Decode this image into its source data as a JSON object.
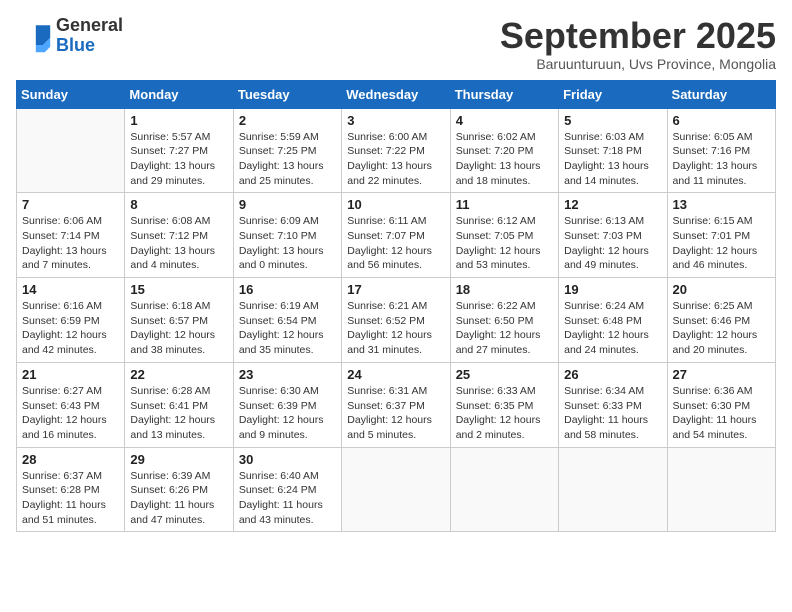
{
  "logo": {
    "general": "General",
    "blue": "Blue"
  },
  "title": "September 2025",
  "location": "Baruunturuun, Uvs Province, Mongolia",
  "days_of_week": [
    "Sunday",
    "Monday",
    "Tuesday",
    "Wednesday",
    "Thursday",
    "Friday",
    "Saturday"
  ],
  "weeks": [
    [
      {
        "day": "",
        "info": ""
      },
      {
        "day": "1",
        "info": "Sunrise: 5:57 AM\nSunset: 7:27 PM\nDaylight: 13 hours\nand 29 minutes."
      },
      {
        "day": "2",
        "info": "Sunrise: 5:59 AM\nSunset: 7:25 PM\nDaylight: 13 hours\nand 25 minutes."
      },
      {
        "day": "3",
        "info": "Sunrise: 6:00 AM\nSunset: 7:22 PM\nDaylight: 13 hours\nand 22 minutes."
      },
      {
        "day": "4",
        "info": "Sunrise: 6:02 AM\nSunset: 7:20 PM\nDaylight: 13 hours\nand 18 minutes."
      },
      {
        "day": "5",
        "info": "Sunrise: 6:03 AM\nSunset: 7:18 PM\nDaylight: 13 hours\nand 14 minutes."
      },
      {
        "day": "6",
        "info": "Sunrise: 6:05 AM\nSunset: 7:16 PM\nDaylight: 13 hours\nand 11 minutes."
      }
    ],
    [
      {
        "day": "7",
        "info": "Sunrise: 6:06 AM\nSunset: 7:14 PM\nDaylight: 13 hours\nand 7 minutes."
      },
      {
        "day": "8",
        "info": "Sunrise: 6:08 AM\nSunset: 7:12 PM\nDaylight: 13 hours\nand 4 minutes."
      },
      {
        "day": "9",
        "info": "Sunrise: 6:09 AM\nSunset: 7:10 PM\nDaylight: 13 hours\nand 0 minutes."
      },
      {
        "day": "10",
        "info": "Sunrise: 6:11 AM\nSunset: 7:07 PM\nDaylight: 12 hours\nand 56 minutes."
      },
      {
        "day": "11",
        "info": "Sunrise: 6:12 AM\nSunset: 7:05 PM\nDaylight: 12 hours\nand 53 minutes."
      },
      {
        "day": "12",
        "info": "Sunrise: 6:13 AM\nSunset: 7:03 PM\nDaylight: 12 hours\nand 49 minutes."
      },
      {
        "day": "13",
        "info": "Sunrise: 6:15 AM\nSunset: 7:01 PM\nDaylight: 12 hours\nand 46 minutes."
      }
    ],
    [
      {
        "day": "14",
        "info": "Sunrise: 6:16 AM\nSunset: 6:59 PM\nDaylight: 12 hours\nand 42 minutes."
      },
      {
        "day": "15",
        "info": "Sunrise: 6:18 AM\nSunset: 6:57 PM\nDaylight: 12 hours\nand 38 minutes."
      },
      {
        "day": "16",
        "info": "Sunrise: 6:19 AM\nSunset: 6:54 PM\nDaylight: 12 hours\nand 35 minutes."
      },
      {
        "day": "17",
        "info": "Sunrise: 6:21 AM\nSunset: 6:52 PM\nDaylight: 12 hours\nand 31 minutes."
      },
      {
        "day": "18",
        "info": "Sunrise: 6:22 AM\nSunset: 6:50 PM\nDaylight: 12 hours\nand 27 minutes."
      },
      {
        "day": "19",
        "info": "Sunrise: 6:24 AM\nSunset: 6:48 PM\nDaylight: 12 hours\nand 24 minutes."
      },
      {
        "day": "20",
        "info": "Sunrise: 6:25 AM\nSunset: 6:46 PM\nDaylight: 12 hours\nand 20 minutes."
      }
    ],
    [
      {
        "day": "21",
        "info": "Sunrise: 6:27 AM\nSunset: 6:43 PM\nDaylight: 12 hours\nand 16 minutes."
      },
      {
        "day": "22",
        "info": "Sunrise: 6:28 AM\nSunset: 6:41 PM\nDaylight: 12 hours\nand 13 minutes."
      },
      {
        "day": "23",
        "info": "Sunrise: 6:30 AM\nSunset: 6:39 PM\nDaylight: 12 hours\nand 9 minutes."
      },
      {
        "day": "24",
        "info": "Sunrise: 6:31 AM\nSunset: 6:37 PM\nDaylight: 12 hours\nand 5 minutes."
      },
      {
        "day": "25",
        "info": "Sunrise: 6:33 AM\nSunset: 6:35 PM\nDaylight: 12 hours\nand 2 minutes."
      },
      {
        "day": "26",
        "info": "Sunrise: 6:34 AM\nSunset: 6:33 PM\nDaylight: 11 hours\nand 58 minutes."
      },
      {
        "day": "27",
        "info": "Sunrise: 6:36 AM\nSunset: 6:30 PM\nDaylight: 11 hours\nand 54 minutes."
      }
    ],
    [
      {
        "day": "28",
        "info": "Sunrise: 6:37 AM\nSunset: 6:28 PM\nDaylight: 11 hours\nand 51 minutes."
      },
      {
        "day": "29",
        "info": "Sunrise: 6:39 AM\nSunset: 6:26 PM\nDaylight: 11 hours\nand 47 minutes."
      },
      {
        "day": "30",
        "info": "Sunrise: 6:40 AM\nSunset: 6:24 PM\nDaylight: 11 hours\nand 43 minutes."
      },
      {
        "day": "",
        "info": ""
      },
      {
        "day": "",
        "info": ""
      },
      {
        "day": "",
        "info": ""
      },
      {
        "day": "",
        "info": ""
      }
    ]
  ]
}
